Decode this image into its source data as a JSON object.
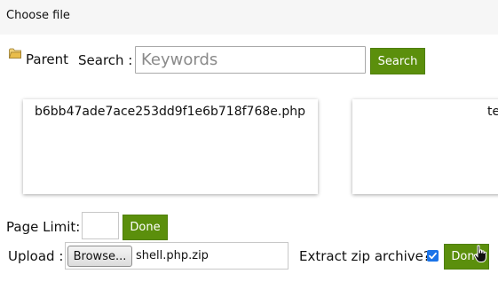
{
  "dialog": {
    "title": "Choose file"
  },
  "toolbar": {
    "parent_label": "Parent",
    "search_label": "Search :",
    "search_placeholder": "Keywords",
    "search_value": "",
    "search_button": "Search"
  },
  "files": [
    {
      "name": "b6bb47ade7ace253dd9f1e6b718f768e.php"
    },
    {
      "name": "te"
    }
  ],
  "pagination": {
    "limit_label": "Page Limit:",
    "limit_value": "",
    "done_label": "Done"
  },
  "upload": {
    "label": "Upload :",
    "browse_label": "Browse...",
    "file_name": "shell.php.zip",
    "extract_label": "Extract zip archive?",
    "extract_checked": true,
    "done_label": "Done"
  },
  "icons": {
    "folder": "folder-icon",
    "checkbox": "checkmark-icon",
    "cursor": "hand-pointer-cursor"
  },
  "colors": {
    "accent_green": "#5b8f0c",
    "checkbox_blue": "#1a73e8",
    "header_bg": "#f6f6f6"
  }
}
